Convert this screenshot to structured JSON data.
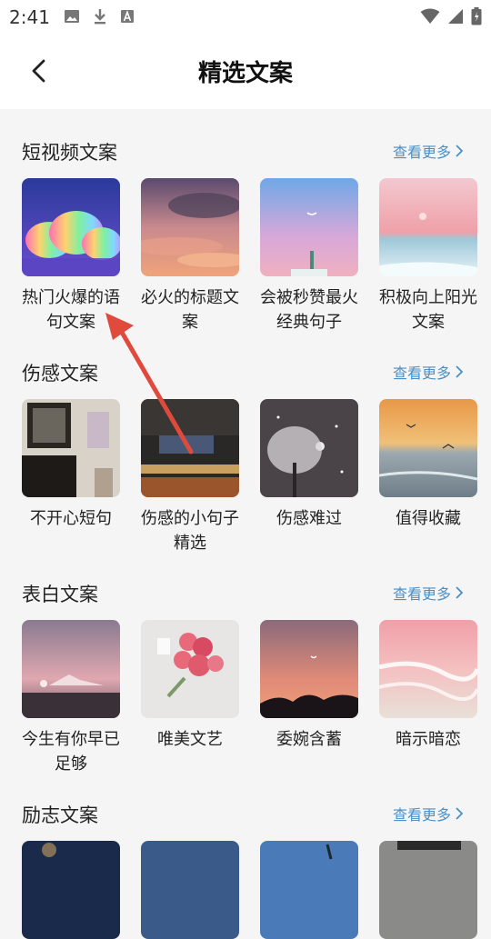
{
  "status_bar": {
    "time": "2:41"
  },
  "header": {
    "title": "精选文案"
  },
  "sections": [
    {
      "title": "短视频文案",
      "more": "查看更多",
      "items": [
        {
          "label": "热门火爆的语句文案"
        },
        {
          "label": "必火的标题文案"
        },
        {
          "label": "会被秒赞最火经典句子"
        },
        {
          "label": "积极向上阳光文案"
        }
      ]
    },
    {
      "title": "伤感文案",
      "more": "查看更多",
      "items": [
        {
          "label": "不开心短句"
        },
        {
          "label": "伤感的小句子精选"
        },
        {
          "label": "伤感难过"
        },
        {
          "label": "值得收藏"
        }
      ]
    },
    {
      "title": "表白文案",
      "more": "查看更多",
      "items": [
        {
          "label": "今生有你早已足够"
        },
        {
          "label": "唯美文艺"
        },
        {
          "label": "委婉含蓄"
        },
        {
          "label": "暗示暗恋"
        }
      ]
    },
    {
      "title": "励志文案",
      "more": "查看更多",
      "items": [
        {
          "label": ""
        },
        {
          "label": ""
        },
        {
          "label": ""
        },
        {
          "label": ""
        }
      ]
    }
  ],
  "colors": {
    "accent_link": "#4a90c6",
    "annotation_arrow": "#e04a3c"
  }
}
